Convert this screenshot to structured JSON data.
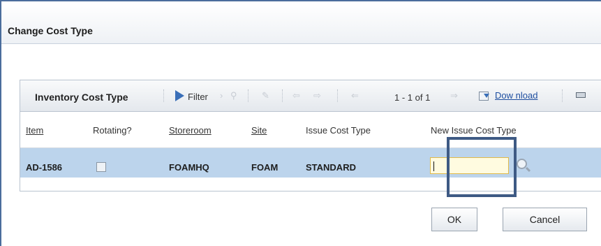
{
  "dialog": {
    "title": "Change Cost Type"
  },
  "table": {
    "title": "Inventory Cost Type",
    "toolbar": {
      "filter_label": "Filter",
      "page_info": "1 - 1 of 1",
      "download_label": "Dow nload"
    },
    "columns": [
      {
        "label": "Item",
        "link": true
      },
      {
        "label": "Rotating?",
        "link": false
      },
      {
        "label": "Storeroom",
        "link": true
      },
      {
        "label": "Site",
        "link": true
      },
      {
        "label": "Issue Cost Type",
        "link": false
      },
      {
        "label": "New Issue Cost Type",
        "link": false
      }
    ],
    "rows": [
      {
        "item": "AD-1586",
        "rotating": false,
        "storeroom": "FOAMHQ",
        "site": "FOAM",
        "issue_cost_type": "STANDARD",
        "new_issue_cost_type": ""
      }
    ]
  },
  "buttons": {
    "ok": "OK",
    "cancel": "Cancel"
  },
  "colors": {
    "row_selected": "#bcd4ec",
    "link": "#1f4fa0",
    "highlight_box": "#3e5a84",
    "input_focus": "#fffbe0"
  },
  "icons": [
    "filter-icon",
    "download-icon",
    "lookup-icon",
    "table-menu-icon"
  ]
}
